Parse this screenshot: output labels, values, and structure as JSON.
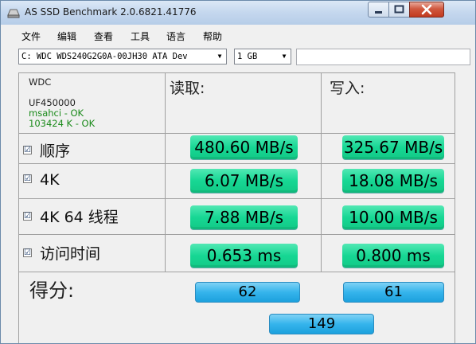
{
  "window": {
    "title": "AS SSD Benchmark 2.0.6821.41776"
  },
  "menu": [
    "文件",
    "编辑",
    "查看",
    "工具",
    "语言",
    "帮助"
  ],
  "drive_select": {
    "value": "C: WDC WDS240G2G0A-00JH30 ATA Dev"
  },
  "size_select": {
    "value": "1 GB"
  },
  "drive_info": {
    "vendor": "WDC",
    "firmware": "UF450000",
    "driver_status": "msahci - OK",
    "alignment_status": "103424 K - OK"
  },
  "headers": {
    "read": "读取:",
    "write": "写入:"
  },
  "rows": [
    {
      "label": "顺序",
      "read": "480.60 MB/s",
      "write": "325.67 MB/s"
    },
    {
      "label": "4K",
      "read": "6.07 MB/s",
      "write": "18.08 MB/s"
    },
    {
      "label": "4K 64 线程",
      "read": "7.88 MB/s",
      "write": "10.00 MB/s"
    },
    {
      "label": "访问时间",
      "read": "0.653 ms",
      "write": "0.800 ms"
    }
  ],
  "score": {
    "label": "得分:",
    "read": "62",
    "write": "61",
    "total": "149"
  },
  "checkmark": "☑",
  "colors": {
    "value_box": "#17d794",
    "score_box": "#35b4ec",
    "ok_text": "#1a8a1a"
  }
}
